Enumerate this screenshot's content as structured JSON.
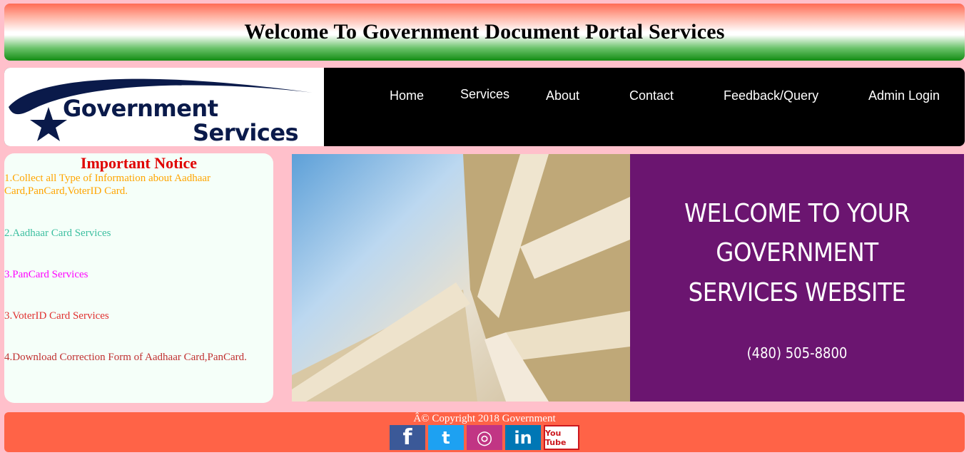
{
  "header": {
    "title": "Welcome To Government Document Portal Services"
  },
  "logo": {
    "line1": "Government",
    "line2": "Services"
  },
  "nav": {
    "items": [
      {
        "label": "Home"
      },
      {
        "label": "Services"
      },
      {
        "label": "About"
      },
      {
        "label": "Contact"
      },
      {
        "label": "Feedback/Query"
      },
      {
        "label": "Admin Login"
      }
    ]
  },
  "notice": {
    "title": "Important Notice",
    "items": [
      {
        "text": "1.Collect all Type of Information about Aadhaar Card,PanCard,VoterID Card.",
        "color": "#ffa500"
      },
      {
        "text": "2.Aadhaar Card Services",
        "color": "#3cbfa0"
      },
      {
        "text": "3.PanCard Services",
        "color": "#ff00ff"
      },
      {
        "text": "3.VoterID Card Services",
        "color": "#e03030"
      },
      {
        "text": "4.Download Correction Form of Aadhaar Card,PanCard.",
        "color": "#c03030"
      }
    ]
  },
  "hero": {
    "lines": [
      "WELCOME TO YOUR",
      "GOVERNMENT",
      "SERVICES WEBSITE"
    ],
    "phone": "(480) 505-8800"
  },
  "footer": {
    "copyright": "Â© Copyright 2018 Government",
    "socials": [
      {
        "icon": "facebook-icon",
        "glyph": "f",
        "color": "#3b5998"
      },
      {
        "icon": "twitter-icon",
        "glyph": "t",
        "color": "#1da1f2"
      },
      {
        "icon": "instagram-icon",
        "glyph": "◎",
        "color": "#c13584"
      },
      {
        "icon": "linkedin-icon",
        "glyph": "in",
        "color": "#0077b5"
      },
      {
        "icon": "youtube-icon",
        "glyph": "You Tube",
        "color": "#cc181e"
      }
    ]
  }
}
